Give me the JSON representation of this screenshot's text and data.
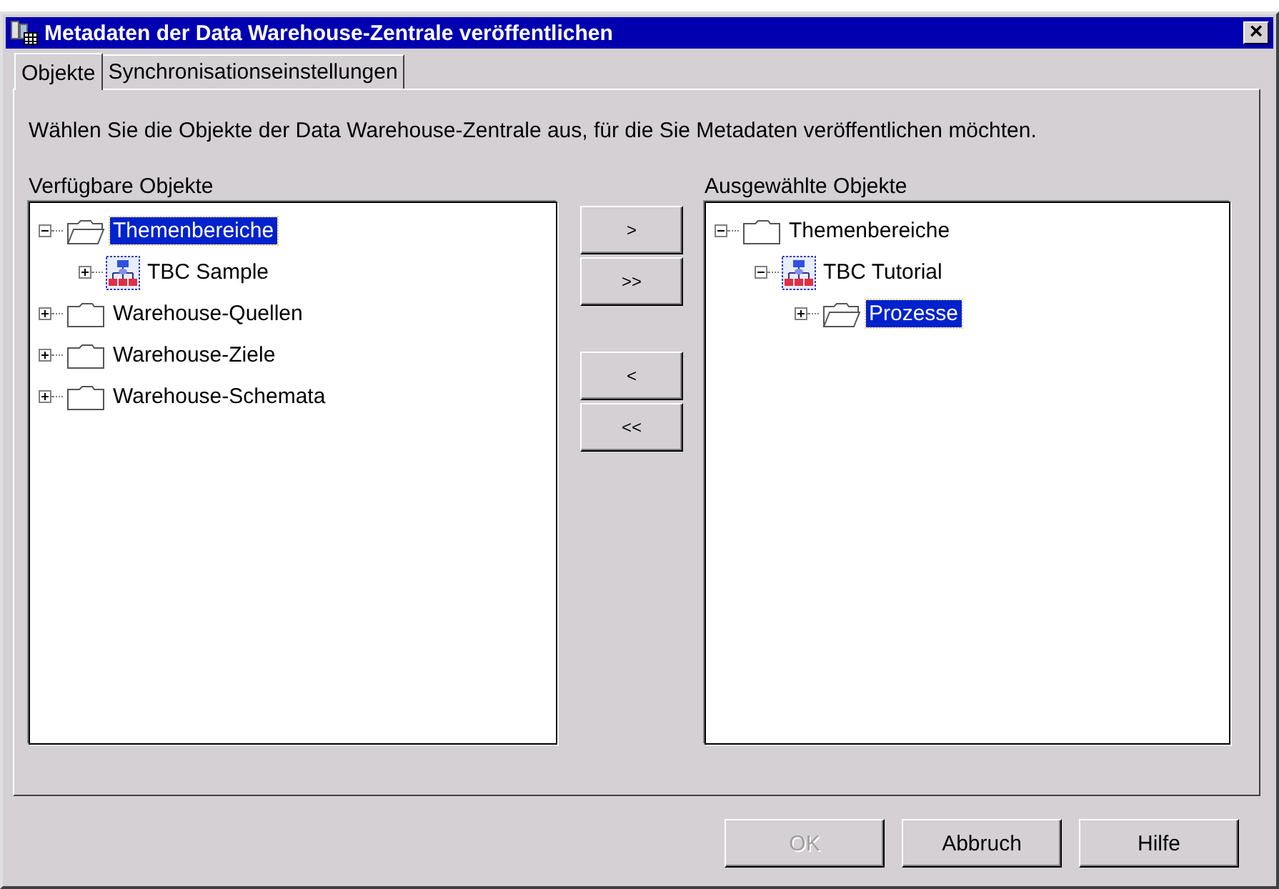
{
  "window": {
    "title": "Metadaten der Data Warehouse-Zentrale veröffentlichen",
    "close_button": "×"
  },
  "tabs": [
    {
      "label": "Objekte",
      "selected": true
    },
    {
      "label": "Synchronisationseinstellungen",
      "selected": false
    }
  ],
  "instruction": "Wählen Sie die Objekte der Data Warehouse-Zentrale aus, für die Sie Metadaten veröffentlichen möchten.",
  "available": {
    "label": "Verfügbare Objekte",
    "tree": [
      {
        "label": "Themenbereiche",
        "kind": "open-folder",
        "expanded": true,
        "selected": true,
        "children": [
          {
            "label": "TBC Sample",
            "kind": "model",
            "expanded": false,
            "selected": false
          }
        ]
      },
      {
        "label": "Warehouse-Quellen",
        "kind": "folder",
        "expanded": false,
        "selected": false
      },
      {
        "label": "Warehouse-Ziele",
        "kind": "folder",
        "expanded": false,
        "selected": false
      },
      {
        "label": "Warehouse-Schemata",
        "kind": "folder",
        "expanded": false,
        "selected": false
      }
    ]
  },
  "move_buttons": [
    ">",
    ">>",
    "<",
    "<<"
  ],
  "selected_objects": {
    "label": "Ausgewählte Objekte",
    "tree": [
      {
        "label": "Themenbereiche",
        "kind": "folder",
        "expanded": true,
        "selected": false,
        "children": [
          {
            "label": "TBC Tutorial",
            "kind": "model",
            "expanded": true,
            "selected": false,
            "children": [
              {
                "label": "Prozesse",
                "kind": "open-folder",
                "expanded": false,
                "selected": true
              }
            ]
          }
        ]
      }
    ]
  },
  "buttons": [
    {
      "label": "OK",
      "disabled": true
    },
    {
      "label": "Abbruch",
      "disabled": false
    },
    {
      "label": "Hilfe",
      "disabled": false
    }
  ]
}
